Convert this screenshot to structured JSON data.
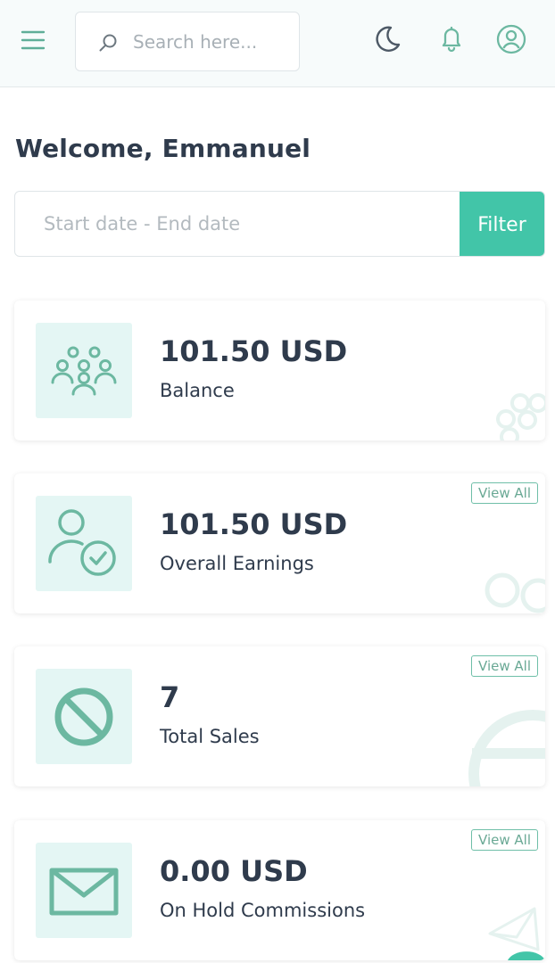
{
  "header": {
    "search_placeholder": "Search here...",
    "icons": [
      "menu-icon",
      "search-icon",
      "moon-icon",
      "bell-icon",
      "user-icon"
    ]
  },
  "welcome": "Welcome, Emmanuel",
  "date_filter": {
    "placeholder": "Start date - End date",
    "button_label": "Filter"
  },
  "cards": [
    {
      "value": "101.50 USD",
      "label": "Balance",
      "icon": "users-group-icon"
    },
    {
      "value": "101.50 USD",
      "label": "Overall Earnings",
      "icon": "user-check-icon",
      "view_all": "View All"
    },
    {
      "value": "7",
      "label": "Total Sales",
      "icon": "ban-icon",
      "view_all": "View All"
    },
    {
      "value": "0.00 USD",
      "label": "On Hold Commissions",
      "icon": "envelope-icon",
      "view_all": "View All"
    }
  ],
  "colors": {
    "accent": "#42c5a8",
    "icon_green": "#6cb8a1",
    "icon_bg": "#e4f6f4",
    "text": "#2f3b4c",
    "topbar_bg": "#f7fbfb"
  }
}
